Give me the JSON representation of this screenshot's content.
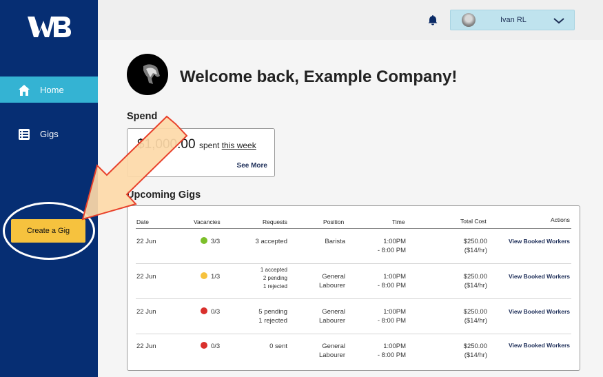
{
  "sidebar": {
    "logo_text": "WB",
    "items": [
      {
        "label": "Home",
        "icon": "home-icon",
        "active": true
      },
      {
        "label": "Gigs",
        "icon": "list-icon",
        "active": false
      }
    ],
    "create_button": "Create a Gig"
  },
  "header": {
    "user_name": "Ivan RL"
  },
  "welcome": "Welcome back, Example Company!",
  "spend": {
    "title": "Spend",
    "amount": "$1,000.00",
    "text_prefix": "spent",
    "text_link": "this week",
    "see_more": "See More"
  },
  "gigs": {
    "title": "Upcoming Gigs",
    "columns": [
      "Date",
      "Vacancies",
      "Requests",
      "Position",
      "Time",
      "Total Cost",
      "Actions"
    ],
    "rows": [
      {
        "date": "22 Jun",
        "status_color": "#7cbf2a",
        "vacancies": "3/3",
        "requests": [
          "3 accepted"
        ],
        "position": [
          "Barista"
        ],
        "time": [
          "1:00PM",
          "- 8:00 PM"
        ],
        "cost": [
          "$250.00",
          "($14/hr)"
        ],
        "action": "View Booked Workers"
      },
      {
        "date": "22 Jun",
        "status_color": "#f6c23e",
        "vacancies": "1/3",
        "requests": [
          "1 accepted",
          "2 pending",
          "1 rejected"
        ],
        "position": [
          "General",
          "Labourer"
        ],
        "time": [
          "1:00PM",
          "- 8:00 PM"
        ],
        "cost": [
          "$250.00",
          "($14/hr)"
        ],
        "action": "View Booked Workers"
      },
      {
        "date": "22 Jun",
        "status_color": "#d9302c",
        "vacancies": "0/3",
        "requests": [
          "5 pending",
          "1 rejected"
        ],
        "position": [
          "General",
          "Labourer"
        ],
        "time": [
          "1:00PM",
          "- 8:00 PM"
        ],
        "cost": [
          "$250.00",
          "($14/hr)"
        ],
        "action": "View Booked Workers"
      },
      {
        "date": "22 Jun",
        "status_color": "#d9302c",
        "vacancies": "0/3",
        "requests": [
          "0 sent"
        ],
        "position": [
          "General",
          "Labourer"
        ],
        "time": [
          "1:00PM",
          "- 8:00 PM"
        ],
        "cost": [
          "$250.00",
          "($14/hr)"
        ],
        "action": "View Booked Workers"
      }
    ]
  },
  "colors": {
    "sidebar": "#062e73",
    "active_nav": "#34b3d3",
    "create_button": "#f6c23e",
    "user_button": "#bfe3ee",
    "annotation_arrow_fill": "#fdd9a8",
    "annotation_arrow_stroke": "#e8402a"
  }
}
